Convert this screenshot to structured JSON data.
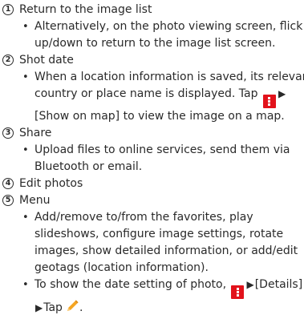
{
  "items": [
    {
      "number": "1",
      "title": "Return to the image list",
      "bullets": [
        [
          "Alternatively, on the photo viewing screen, flick",
          "up/down to return to the image list screen."
        ]
      ]
    },
    {
      "number": "2",
      "title": "Shot date",
      "bullets": [
        [
          "When a location information is saved, its relevant",
          "country or place name is displayed. Tap",
          "[Show on map] to view the image on a map."
        ]
      ]
    },
    {
      "number": "3",
      "title": "Share",
      "bullets": [
        [
          "Upload files to online services, send them via",
          "Bluetooth or email."
        ]
      ]
    },
    {
      "number": "4",
      "title": "Edit photos",
      "bullets": []
    },
    {
      "number": "5",
      "title": "Menu",
      "bullets": [
        [
          "Add/remove to/from the favorites, play",
          "slideshows, configure image settings, rotate",
          "images, show detailed information, or add/edit",
          "geotags (location information)."
        ],
        [
          "To show the date setting of photo,",
          "[Details]",
          "Tap",
          "."
        ]
      ]
    }
  ],
  "symbols": {
    "arrow": "▶"
  },
  "icons": {
    "menu": "menu-more-icon",
    "edit": "pencil-icon",
    "menu_color": "#e2121b",
    "edit_color": "#f5a623"
  }
}
